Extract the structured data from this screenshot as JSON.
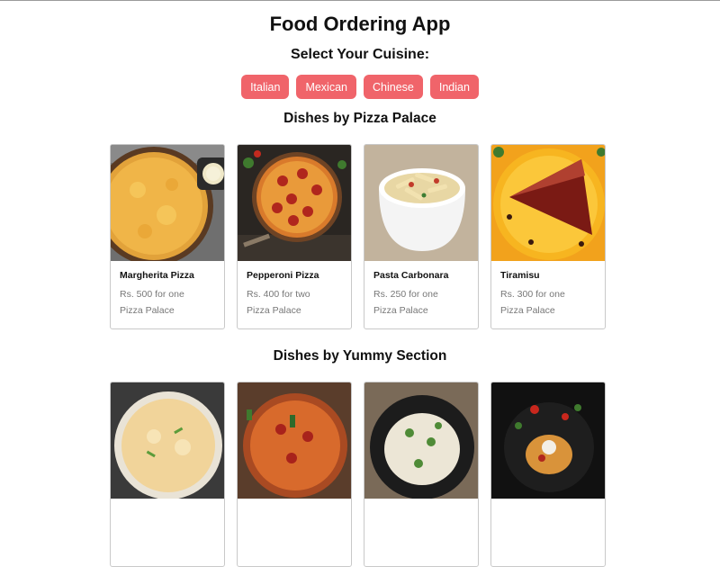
{
  "app": {
    "title": "Food Ordering App",
    "select_label": "Select Your Cuisine:"
  },
  "cuisines": [
    "Italian",
    "Mexican",
    "Chinese",
    "Indian"
  ],
  "colors": {
    "accent": "#f0646a"
  },
  "sections": [
    {
      "title": "Dishes by Pizza Palace",
      "dishes": [
        {
          "name": "Margherita Pizza",
          "price": "Rs. 500 for one",
          "restaurant": "Pizza Palace"
        },
        {
          "name": "Pepperoni Pizza",
          "price": "Rs. 400 for two",
          "restaurant": "Pizza Palace"
        },
        {
          "name": "Pasta Carbonara",
          "price": "Rs. 250 for one",
          "restaurant": "Pizza Palace"
        },
        {
          "name": "Tiramisu",
          "price": "Rs. 300 for one",
          "restaurant": "Pizza Palace"
        }
      ]
    },
    {
      "title": "Dishes by Yummy Section"
    }
  ]
}
